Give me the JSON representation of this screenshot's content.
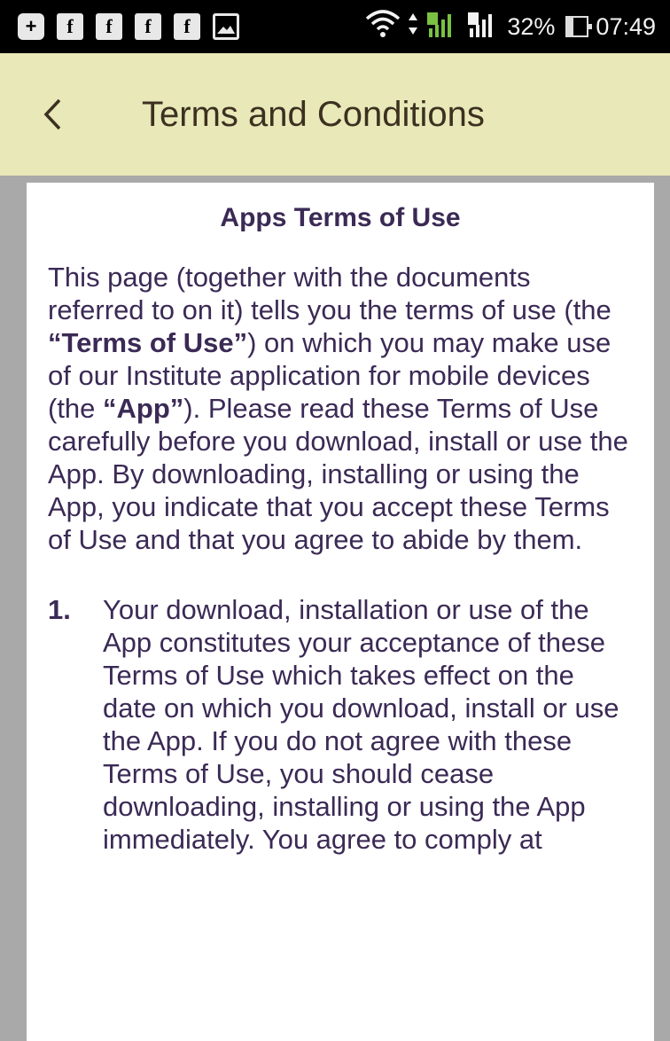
{
  "status_bar": {
    "notification_icons": [
      "plus-icon",
      "facebook-icon",
      "facebook-icon",
      "facebook-icon",
      "facebook-icon",
      "image-icon"
    ],
    "plus_glyph": "+",
    "facebook_glyph": "f",
    "battery_percent_value": 32,
    "battery_text": "32%",
    "time": "07:49"
  },
  "app_bar": {
    "title": "Terms and Conditions",
    "background": "#e8e8b8"
  },
  "content": {
    "heading": "Apps Terms of Use",
    "intro": {
      "part1": "This page (together with the documents referred to on it) tells you the terms of use (the ",
      "bold1": "“Terms of Use”",
      "part2": ") on which you may make use of our Institute application for mobile devices (the ",
      "bold2": "“App”",
      "part3": "). Please read these Terms of Use carefully before you download, install or use the App. By downloading, installing or using the App, you indicate that you accept these Terms of Use and that you agree to abide by them."
    },
    "items": [
      {
        "number": "1.",
        "text": "Your download, installation or use of the App constitutes your acceptance of these Terms of Use which takes effect on the date on which you download, install or use the App. If you do not agree with these Terms of Use, you should cease downloading, installing or using the App immediately. You agree to comply at"
      }
    ],
    "text_color": "#3b2a55"
  }
}
